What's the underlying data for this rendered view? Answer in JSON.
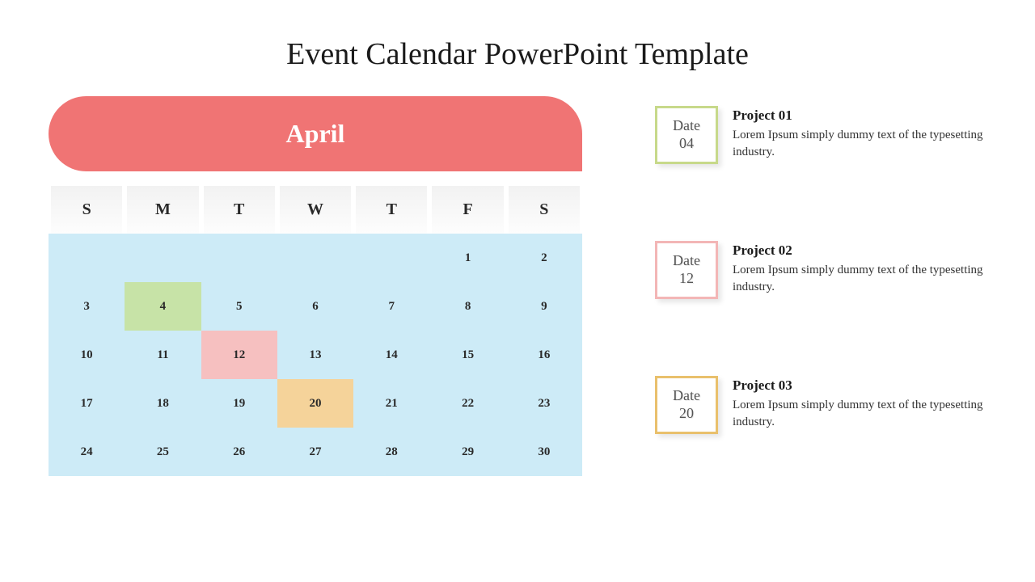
{
  "title": "Event Calendar PowerPoint Template",
  "month": "April",
  "dayHeaders": [
    "S",
    "M",
    "T",
    "W",
    "T",
    "F",
    "S"
  ],
  "startBlank": 5,
  "daysInMonth": 30,
  "highlights": {
    "4": "green",
    "12": "pink",
    "20": "orange"
  },
  "events": [
    {
      "dateLabel": "Date",
      "dateNum": "04",
      "color": "green",
      "title": "Project 01",
      "desc": "Lorem Ipsum simply dummy text of the typesetting industry."
    },
    {
      "dateLabel": "Date",
      "dateNum": "12",
      "color": "pink",
      "title": "Project 02",
      "desc": "Lorem Ipsum simply dummy text of the typesetting industry."
    },
    {
      "dateLabel": "Date",
      "dateNum": "20",
      "color": "orange",
      "title": "Project 03",
      "desc": "Lorem Ipsum simply dummy text of the typesetting industry."
    }
  ]
}
